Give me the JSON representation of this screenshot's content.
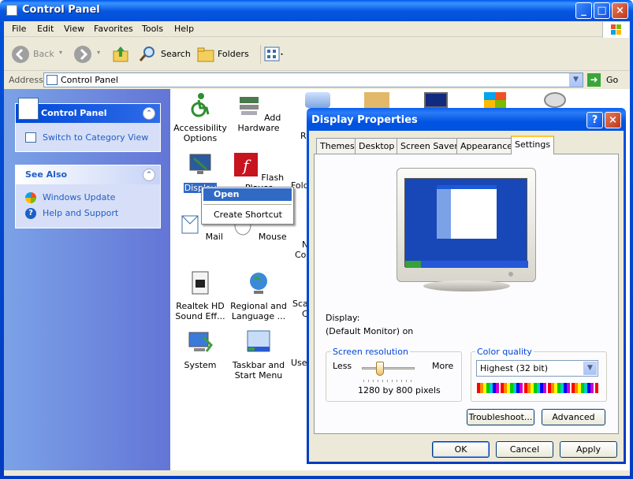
{
  "window": {
    "title": "Control Panel"
  },
  "menu": [
    "File",
    "Edit",
    "View",
    "Favorites",
    "Tools",
    "Help"
  ],
  "toolbar": {
    "back": "Back",
    "search": "Search",
    "folders": "Folders"
  },
  "address": {
    "label": "Address",
    "value": "Control Panel",
    "go": "Go"
  },
  "left": {
    "panel_title": "Control Panel",
    "switch_view": "Switch to Category View",
    "see_also": "See Also",
    "windows_update": "Windows Update",
    "help_support": "Help and Support"
  },
  "items": [
    {
      "label": "Accessibility Options"
    },
    {
      "label": "Add Hardware"
    },
    {
      "label": "Display"
    },
    {
      "label": "Flash Player"
    },
    {
      "label": "Mail"
    },
    {
      "label": "Mouse"
    },
    {
      "label": "Realtek HD Sound Eff..."
    },
    {
      "label": "Regional and Language ..."
    },
    {
      "label": "System"
    },
    {
      "label": "Taskbar and Start Menu"
    }
  ],
  "partial_labels": {
    "r1": "R",
    "folder": "Fold",
    "n": "N",
    "con": "Con",
    "sca": "Sca",
    "c": "C",
    "user": "User"
  },
  "context_menu": {
    "open": "Open",
    "create_shortcut": "Create Shortcut"
  },
  "dialog": {
    "title": "Display Properties",
    "tabs": [
      "Themes",
      "Desktop",
      "Screen Saver",
      "Appearance",
      "Settings"
    ],
    "display_label": "Display:",
    "display_value": "(Default Monitor) on",
    "resolution": {
      "label": "Screen resolution",
      "less": "Less",
      "more": "More",
      "value": "1280 by 800 pixels",
      "slider_fraction": 0.35
    },
    "color": {
      "label": "Color quality",
      "value": "Highest (32 bit)"
    },
    "troubleshoot": "Troubleshoot...",
    "advanced": "Advanced",
    "ok": "OK",
    "cancel": "Cancel",
    "apply": "Apply"
  }
}
